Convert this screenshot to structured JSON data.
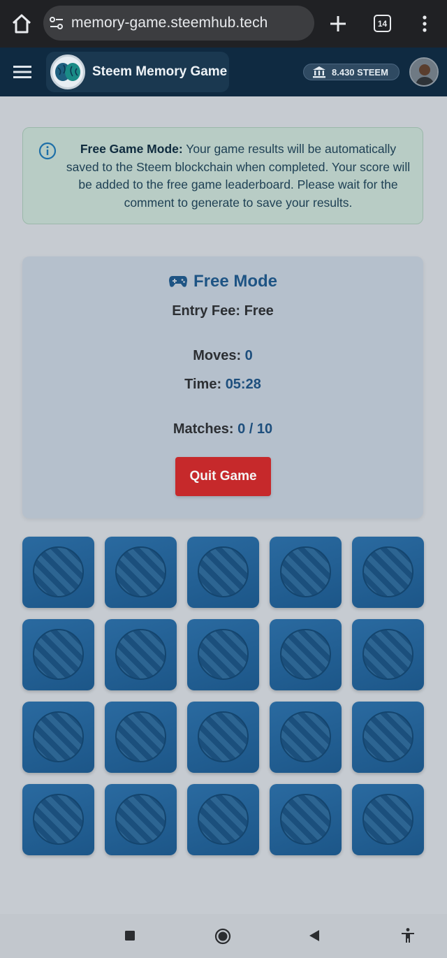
{
  "browser": {
    "url": "memory-game.steemhub.tech",
    "tab_count": "14"
  },
  "header": {
    "title": "Steem Memory Game",
    "balance": "8.430 STEEM"
  },
  "info": {
    "label": "Free Game Mode:",
    "message": " Your game results will be automatically saved to the Steem blockchain when completed. Your score will be added to the free game leaderboard. Please wait for the comment to generate to save your results."
  },
  "panel": {
    "mode": "Free Mode",
    "entry_fee_label": "Entry Fee:",
    "entry_fee_value": "Free",
    "moves_label": "Moves:",
    "moves_value": "0",
    "time_label": "Time:",
    "time_value": "05:28",
    "matches_label": "Matches:",
    "matches_value": "0 / 10",
    "quit_label": "Quit Game"
  },
  "board": {
    "rows": 4,
    "cols": 5,
    "face_down_cards": 20
  },
  "colors": {
    "accent": "#1e5484",
    "danger": "#c6292b",
    "card": "#2a6aa0"
  },
  "icons": [
    "home-icon",
    "site-settings-icon",
    "plus-icon",
    "more-vert-icon",
    "hamburger-icon",
    "brain-logo-icon",
    "bank-icon",
    "info-icon",
    "gamepad-icon",
    "square-icon",
    "circle-icon",
    "back-triangle-icon",
    "accessibility-icon"
  ]
}
